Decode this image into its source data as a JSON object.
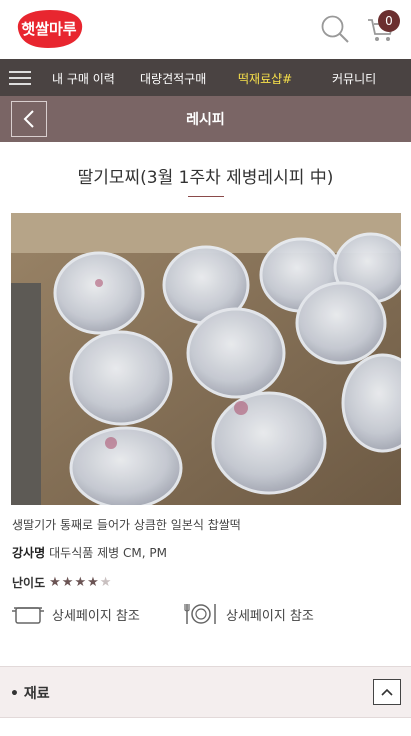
{
  "header": {
    "logo_text": "햇쌀마루",
    "cart_count": "0",
    "icons": {
      "search": "search-icon",
      "cart": "cart-icon"
    }
  },
  "nav": {
    "items": [
      {
        "label": "내 구매 이력"
      },
      {
        "label": "대량견적구매"
      },
      {
        "label": "떡재료샵#"
      },
      {
        "label": "커뮤니티"
      }
    ],
    "active_color": "#f7e04a"
  },
  "subheader": {
    "title": "레시피"
  },
  "recipe": {
    "title": "딸기모찌(3월 1주차 제병레시피 中)",
    "description": "생딸기가 통째로 들어가 상큼한 일본식 찹쌀떡",
    "instructor_label": "강사명",
    "instructor_value": "대두식품 제병 CM, PM",
    "difficulty_label": "난이도",
    "difficulty_rating": 4,
    "difficulty_max": 5
  },
  "references": [
    {
      "icon": "pot-icon",
      "label": "상세페이지 참조"
    },
    {
      "icon": "tableware-icon",
      "label": "상세페이지 참조"
    }
  ],
  "section": {
    "title": "• 재료"
  },
  "colors": {
    "nav_bg": "#4a4342",
    "subheader_bg": "#7a6565",
    "badge": "#6b2f2f",
    "logo": "#e8262f"
  }
}
